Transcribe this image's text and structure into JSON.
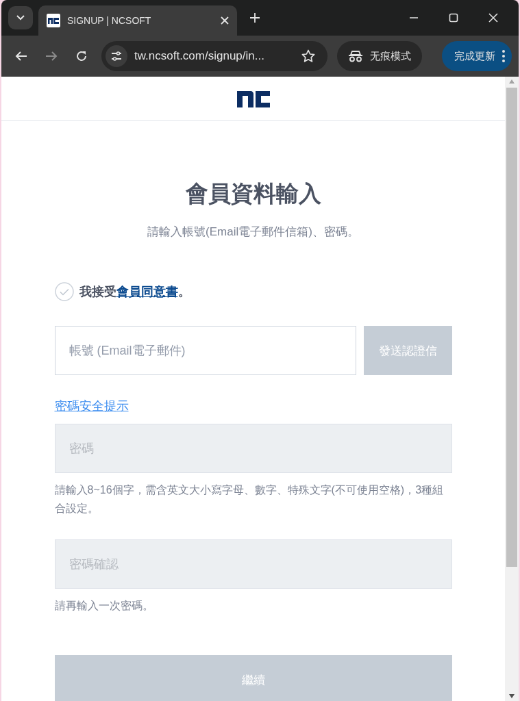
{
  "browser": {
    "tab": {
      "title": "SIGNUP | NCSOFT",
      "selected": true
    },
    "url": "tw.ncsoft.com/signup/in...",
    "incognito_label": "无痕模式",
    "update_button": "完成更新"
  },
  "page": {
    "title": "會員資料輸入",
    "subtitle": "請輸入帳號(Email電子郵件信箱)、密碼。",
    "agreement": {
      "prefix": "我接受",
      "link": "會員同意書",
      "suffix": "。",
      "checked": false
    },
    "email_field": {
      "placeholder": "帳號 (Email電子郵件)",
      "disabled": false
    },
    "send_button": {
      "label": "發送認證信",
      "disabled": true
    },
    "password_tips_link": "密碼安全提示",
    "password_field": {
      "placeholder": "密碼",
      "disabled": true
    },
    "password_help": "請輸入8~16個字，需含英文大小寫字母、數字、特殊文字(不可使用空格)，3種組合設定。",
    "confirm_field": {
      "placeholder": "密碼確認",
      "disabled": true
    },
    "confirm_help": "請再輸入一次密碼。",
    "continue_button": {
      "label": "繼續",
      "disabled": true
    }
  }
}
